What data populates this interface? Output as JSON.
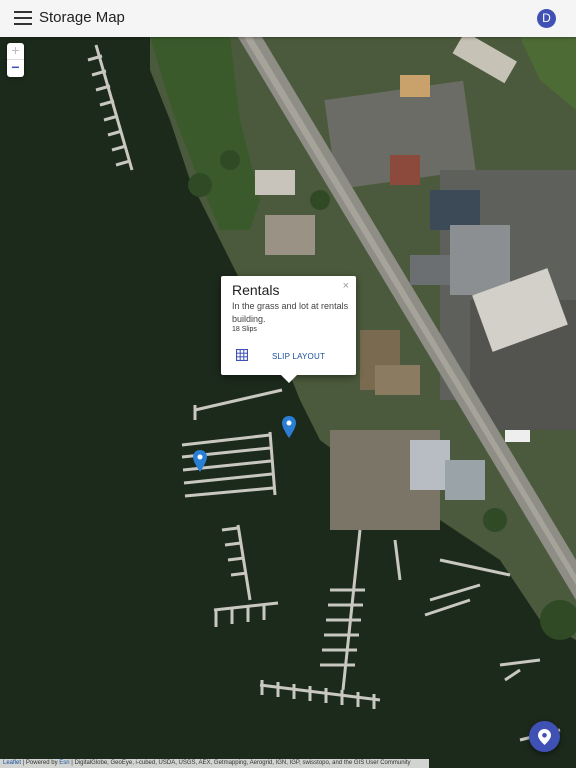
{
  "app": {
    "title": "Storage Map",
    "avatar_initial": "D",
    "accent_color": "#3f51b5"
  },
  "map": {
    "zoom_in_label": "+",
    "zoom_out_label": "−",
    "basemap": "satellite imagery",
    "markers": [
      {
        "icon": "map-pin-icon",
        "color": "#2a7fd4"
      },
      {
        "icon": "map-pin-icon",
        "color": "#2a7fd4"
      }
    ]
  },
  "popup": {
    "close_label": "×",
    "title": "Rentals",
    "description": "In the grass and lot at rentals building.",
    "slip_count": "18 Slips",
    "action_icon": "grid-icon",
    "action_label": "SLIP LAYOUT"
  },
  "fab": {
    "icon": "location-pin-icon"
  },
  "attribution": {
    "leaflet": "Leaflet",
    "separator": " | Powered by ",
    "esri": "Esri",
    "sources": " | DigitalGlobe, GeoEye, i-cubed, USDA, USGS, AEX, Getmapping, Aerogrid, IGN, IGP, swisstopo, and the GIS User Community"
  }
}
